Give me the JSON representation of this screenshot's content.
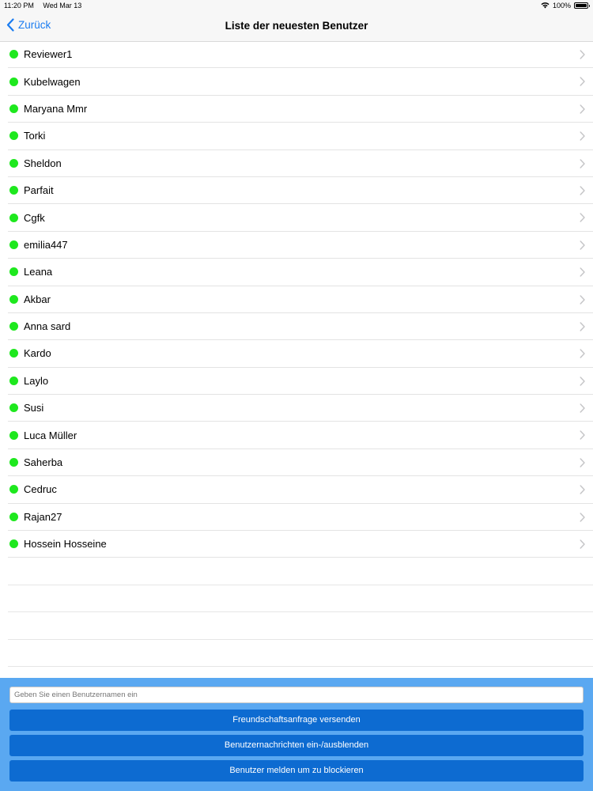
{
  "status_bar": {
    "time": "11:20 PM",
    "date": "Wed Mar 13",
    "battery_text": "100%",
    "battery_level": 1.0
  },
  "nav": {
    "back_label": "Zurück",
    "title": "Liste der neuesten Benutzer"
  },
  "users": [
    {
      "name": "Reviewer1"
    },
    {
      "name": "Kubelwagen"
    },
    {
      "name": "Maryana Mmr"
    },
    {
      "name": "Torki"
    },
    {
      "name": "Sheldon"
    },
    {
      "name": "Parfait"
    },
    {
      "name": "Cgfk"
    },
    {
      "name": "emilia447"
    },
    {
      "name": "Leana"
    },
    {
      "name": "Akbar"
    },
    {
      "name": "Anna sard"
    },
    {
      "name": "Kardo"
    },
    {
      "name": "Laylo"
    },
    {
      "name": "Susi"
    },
    {
      "name": "Luca Müller"
    },
    {
      "name": "Saherba"
    },
    {
      "name": "Cedruc"
    },
    {
      "name": "Rajan27"
    },
    {
      "name": "Hossein Hosseine"
    }
  ],
  "online_color": "#1ee81e",
  "accent_color": "#1a7cf0",
  "bottom": {
    "username_placeholder": "Geben Sie einen Benutzernamen ein",
    "username_value": "",
    "send_request_label": "Freundschaftsanfrage versenden",
    "toggle_messages_label": "Benutzernachrichten ein-/ausblenden",
    "report_label": "Benutzer melden um zu blockieren"
  },
  "icons": {
    "back": "chevron-left-icon",
    "row_disclosure": "chevron-right-icon",
    "online": "online-status-dot",
    "wifi": "wifi-icon",
    "battery": "battery-icon"
  }
}
